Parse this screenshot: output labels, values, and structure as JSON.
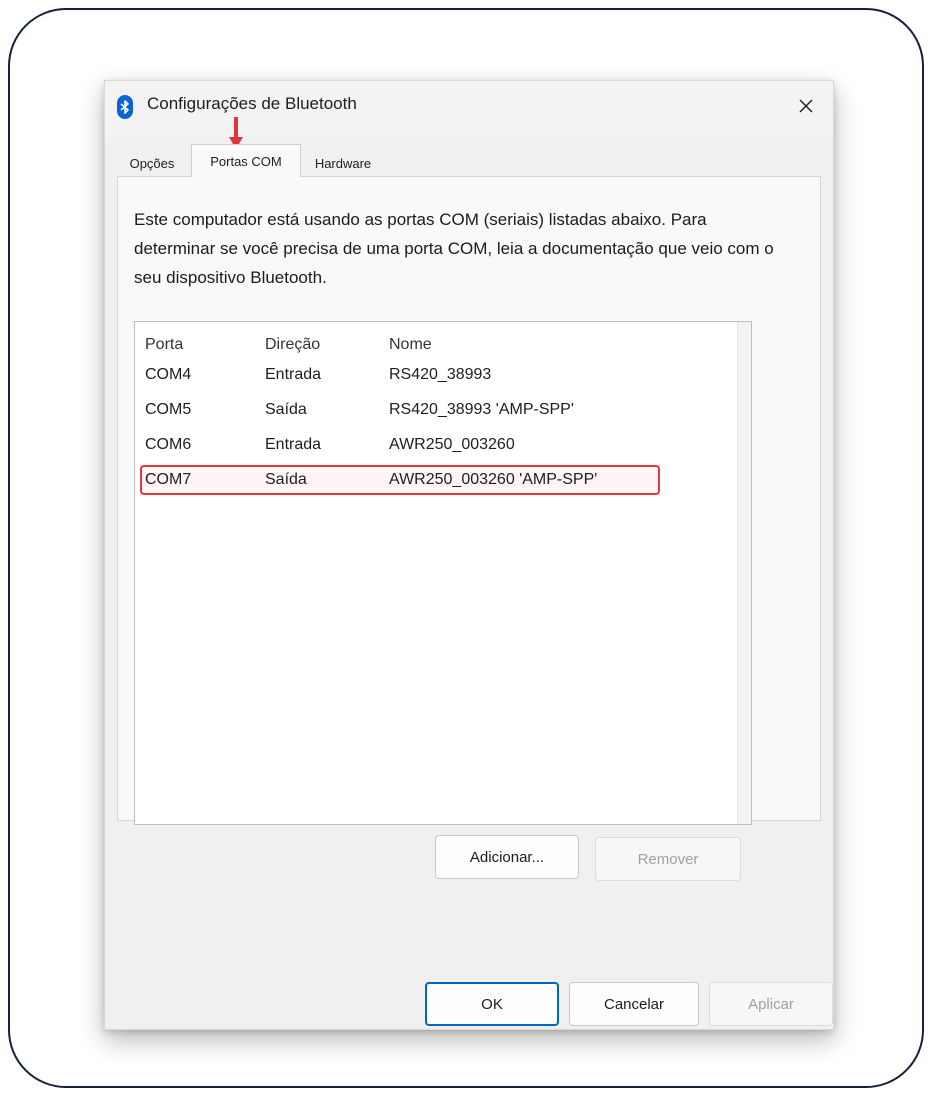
{
  "window": {
    "title": "Configurações de Bluetooth",
    "close_icon": "close-icon",
    "app_icon": "bluetooth-icon"
  },
  "tabs": [
    {
      "label": "Opções",
      "active": false
    },
    {
      "label": "Portas COM",
      "active": true
    },
    {
      "label": "Hardware",
      "active": false
    }
  ],
  "panel": {
    "description": "Este computador está usando as portas COM (seriais) listadas abaixo. Para determinar se você precisa de uma porta COM, leia a documentação que veio com o seu dispositivo Bluetooth."
  },
  "ports_table": {
    "columns": [
      "Porta",
      "Direção",
      "Nome"
    ],
    "rows": [
      [
        "COM4",
        "Entrada",
        "RS420_38993"
      ],
      [
        "COM5",
        "Saída",
        "RS420_38993 'AMP-SPP'"
      ],
      [
        "COM6",
        "Entrada",
        "AWR250_003260"
      ],
      [
        "COM7",
        "Saída",
        "AWR250_003260 'AMP-SPP'"
      ]
    ],
    "highlighted_row": "COM7"
  },
  "panel_buttons": {
    "add": "Adicionar...",
    "remove": "Remover"
  },
  "footer_buttons": {
    "ok": "OK",
    "cancel": "Cancelar",
    "apply": "Aplicar"
  },
  "colors": {
    "annotation": "#e0353e",
    "bluetooth": "#0a64d6",
    "frame": "#15203f"
  }
}
